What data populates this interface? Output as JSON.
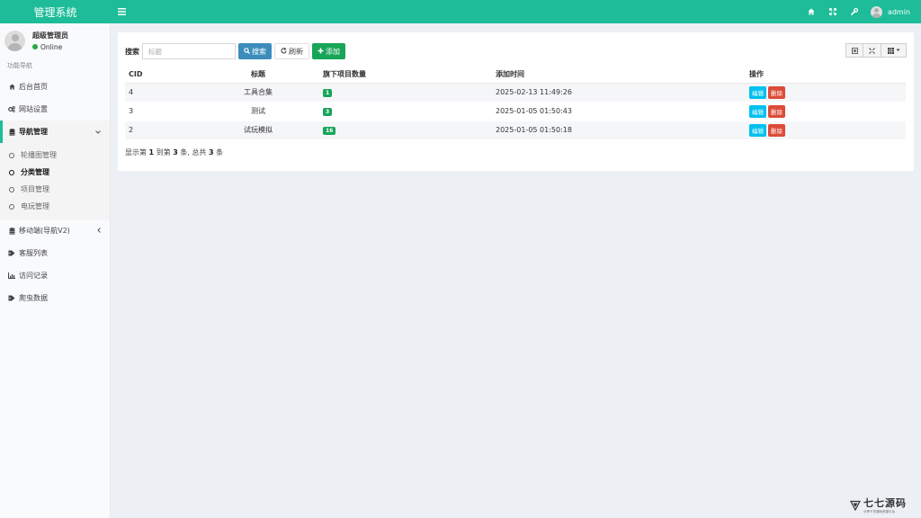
{
  "header": {
    "logo": "管理系统",
    "hamburger_icon": "≡",
    "icons": [
      "home-icon",
      "fullscreen-icon",
      "wrench-icon"
    ],
    "username": "admin"
  },
  "sidebar": {
    "user_name": "超级管理员",
    "user_status": "Online",
    "nav_header": "功能导航",
    "items": [
      {
        "label": "后台首页",
        "icon": "home-icon"
      },
      {
        "label": "网站设置",
        "icon": "cogs-icon"
      },
      {
        "label": "导航管理",
        "icon": "database-icon"
      },
      {
        "label": "移动端(导航V2)",
        "icon": "database-icon"
      },
      {
        "label": "客服列表",
        "icon": "tags-icon"
      },
      {
        "label": "访问记录",
        "icon": "bar-chart-icon"
      },
      {
        "label": "爬虫数据",
        "icon": "tags-icon"
      }
    ],
    "sub_items": [
      {
        "label": "轮播图管理"
      },
      {
        "label": "分类管理"
      },
      {
        "label": "项目管理"
      },
      {
        "label": "电玩管理"
      }
    ]
  },
  "toolbar": {
    "search_label": "搜索",
    "search_placeholder": "标题",
    "search_button": "搜索",
    "refresh_button": "刷新",
    "add_button": "添加"
  },
  "table": {
    "columns": [
      "CID",
      "标题",
      "旗下项目数量",
      "添加时间",
      "操作"
    ],
    "rows": [
      {
        "cid": "4",
        "title": "工具合集",
        "count": "1",
        "time": "2025-02-13 11:49:26"
      },
      {
        "cid": "3",
        "title": "测试",
        "count": "3",
        "time": "2025-01-05 01:50:43"
      },
      {
        "cid": "2",
        "title": "试玩模拟",
        "count": "16",
        "time": "2025-01-05 01:50:18"
      }
    ],
    "edit_label": "编辑",
    "delete_label": "删除"
  },
  "pager": {
    "prefix": "显示第",
    "from": "1",
    "mid1": "到第",
    "to": "3",
    "mid2": "条, 总共",
    "total": "3",
    "suffix": "条"
  },
  "watermark": {
    "title": "七七源码",
    "subtitle": "分享干货源码资源平台"
  },
  "colors": {
    "brand": "#1ebc98",
    "primary": "#3c8dbc",
    "success": "#18a558",
    "info": "#00c0ef",
    "danger": "#dd4b39"
  }
}
